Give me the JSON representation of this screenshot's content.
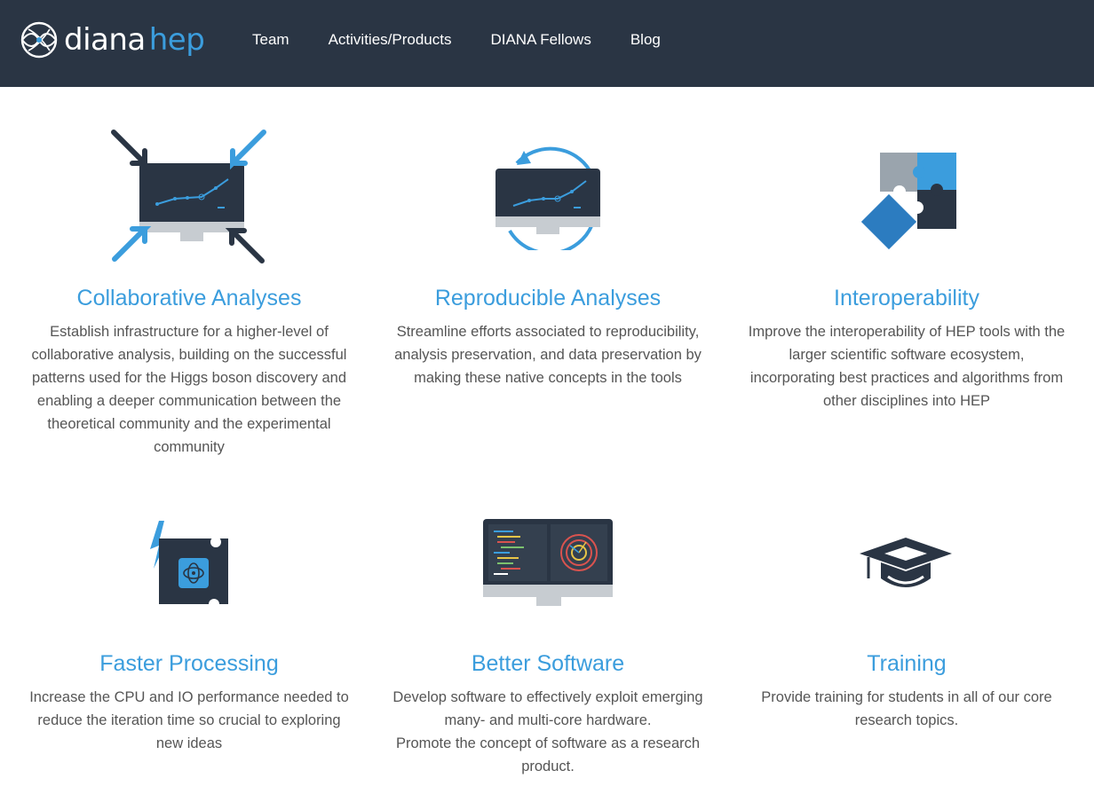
{
  "header": {
    "logo_primary": "diana",
    "logo_secondary": "hep",
    "nav": [
      {
        "label": "Team"
      },
      {
        "label": "Activities/Products"
      },
      {
        "label": "DIANA Fellows"
      },
      {
        "label": "Blog"
      }
    ]
  },
  "colors": {
    "navbar_bg": "#2a3544",
    "accent": "#3b9ddd",
    "dark_navy": "#2a3544",
    "body_text": "#555555"
  },
  "features": [
    {
      "icon": "collaboration-monitor-icon",
      "title": "Collaborative Analyses",
      "text": "Establish infrastructure for a higher-level of collaborative analysis, building on the successful patterns used for the Higgs boson discovery and enabling a deeper communication between the theoretical community and the experimental community"
    },
    {
      "icon": "reproducible-monitor-icon",
      "title": "Reproducible Analyses",
      "text": "Streamline efforts associated to reproducibility, analysis preservation, and data preservation by making these native concepts in the tools"
    },
    {
      "icon": "puzzle-icon",
      "title": "Interoperability",
      "text": "Improve the interoperability of HEP tools with the larger scientific software ecosystem, incorporating best practices and algorithms from other disciplines into HEP"
    },
    {
      "icon": "cpu-lightning-icon",
      "title": "Faster Processing",
      "text": "Increase the CPU and IO performance needed to reduce the iteration time so crucial to exploring new ideas"
    },
    {
      "icon": "code-monitor-icon",
      "title": "Better Software",
      "text": "Develop software to effectively exploit emerging many- and multi-core hardware.",
      "text2": "Promote the concept of software as a research product."
    },
    {
      "icon": "graduation-cap-icon",
      "title": "Training",
      "text": "Provide training for students in all of our core research topics."
    }
  ]
}
